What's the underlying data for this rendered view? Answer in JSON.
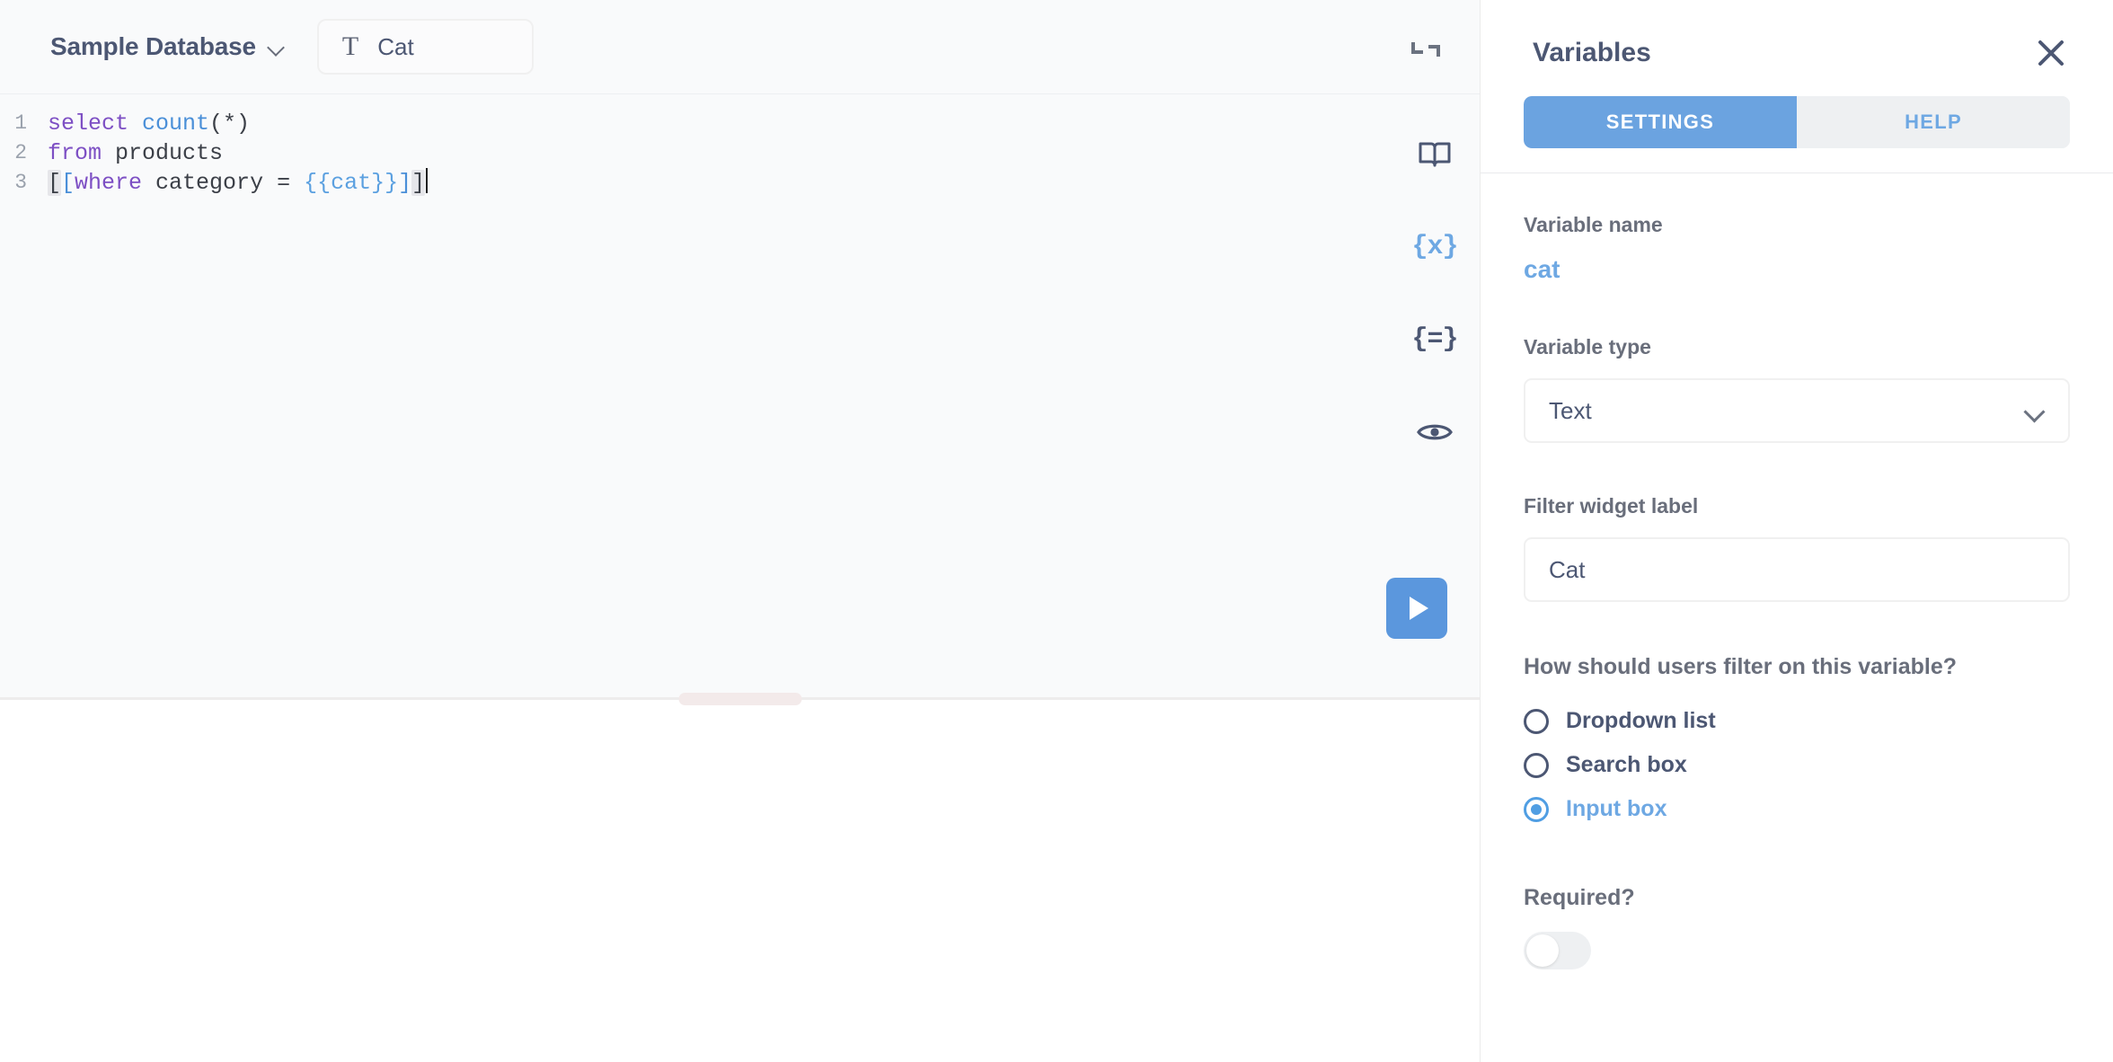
{
  "editor": {
    "database_name": "Sample Database",
    "variable_chip": {
      "type_icon": "text-type-icon",
      "label": "Cat"
    },
    "collapse_icon": "collapse-icon",
    "code": {
      "lines": [
        {
          "number": "1",
          "tokens": [
            {
              "text": "select ",
              "kind": "kw"
            },
            {
              "text": "count",
              "kind": "fn"
            },
            {
              "text": "(*)",
              "kind": "punct"
            }
          ]
        },
        {
          "number": "2",
          "tokens": [
            {
              "text": "from ",
              "kind": "kw"
            },
            {
              "text": "products",
              "kind": "punct"
            }
          ]
        },
        {
          "number": "3",
          "tokens": [
            {
              "text": "[",
              "kind": "brkhl"
            },
            {
              "text": "[",
              "kind": "optbr"
            },
            {
              "text": "where ",
              "kind": "kw"
            },
            {
              "text": "category = ",
              "kind": "punct"
            },
            {
              "text": "{{cat}}",
              "kind": "tmpl"
            },
            {
              "text": "]",
              "kind": "optbr"
            },
            {
              "text": "]",
              "kind": "brkhl"
            }
          ]
        }
      ],
      "plain_text": "select count(*)\nfrom products\n[[where category = {{cat}}]]"
    },
    "rail_icons": [
      {
        "name": "data-reference-icon",
        "glyph": "book",
        "active": false
      },
      {
        "name": "variables-icon",
        "glyph": "{x}",
        "active": true
      },
      {
        "name": "snippets-icon",
        "glyph": "{=}",
        "active": false
      },
      {
        "name": "preview-query-icon",
        "glyph": "eye",
        "active": false
      }
    ],
    "run_button": {
      "name": "run-query-button",
      "icon": "play-icon"
    },
    "drag_handle": "resize-editor-handle"
  },
  "variables_panel": {
    "title": "Variables",
    "close_icon": "close-icon",
    "tabs": [
      {
        "label": "SETTINGS",
        "active": true
      },
      {
        "label": "HELP",
        "active": false
      }
    ],
    "fields": {
      "variable_name_label": "Variable name",
      "variable_name_value": "cat",
      "variable_type_label": "Variable type",
      "variable_type_value": "Text",
      "filter_widget_label_label": "Filter widget label",
      "filter_widget_label_value": "Cat",
      "filter_question": "How should users filter on this variable?",
      "filter_options": [
        {
          "label": "Dropdown list",
          "selected": false
        },
        {
          "label": "Search box",
          "selected": false
        },
        {
          "label": "Input box",
          "selected": true
        }
      ],
      "required_label": "Required?",
      "required_on": false
    }
  },
  "colors": {
    "accent_blue": "#509ee3",
    "tab_active_blue": "#6ba3e0",
    "text_dark": "#4c5773",
    "text_muted": "#696e7b",
    "editor_bg": "#f9fafb",
    "handle_pink": "#f3eaea"
  }
}
